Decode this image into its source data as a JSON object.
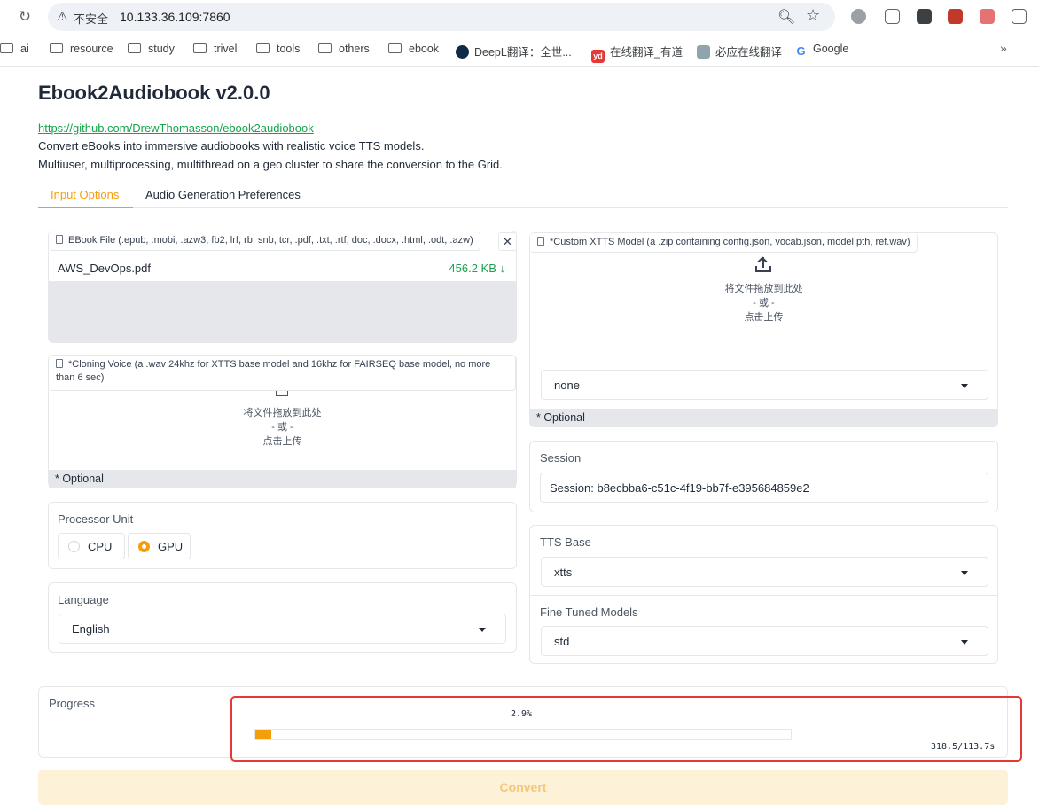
{
  "browser": {
    "security_warning": "不安全",
    "url": "10.133.36.109:7860",
    "bookmarks": [
      {
        "label": "ai",
        "type": "folder"
      },
      {
        "label": "resource",
        "type": "folder"
      },
      {
        "label": "study",
        "type": "folder"
      },
      {
        "label": "trivel",
        "type": "folder"
      },
      {
        "label": "tools",
        "type": "folder"
      },
      {
        "label": "others",
        "type": "folder"
      },
      {
        "label": "ebook",
        "type": "folder"
      },
      {
        "label": "DeepL翻译：全世...",
        "type": "site"
      },
      {
        "label": "在线翻译_有道",
        "type": "site"
      },
      {
        "label": "必应在线翻译",
        "type": "site"
      },
      {
        "label": "Google",
        "type": "site"
      }
    ],
    "bookmarks_overflow": "»"
  },
  "page": {
    "title": "Ebook2Audiobook v2.0.0",
    "github_link": "https://github.com/DrewThomasson/ebook2audiobook",
    "description_1": "Convert eBooks into immersive audiobooks with realistic voice TTS models.",
    "description_2": "Multiuser, multiprocessing, multithread on a geo cluster to share the conversion to the Grid."
  },
  "tabs": [
    {
      "label": "Input Options",
      "active": true
    },
    {
      "label": "Audio Generation Preferences",
      "active": false
    }
  ],
  "ebook_file": {
    "label": "EBook File (.epub, .mobi, .azw3, fb2, lrf, rb, snb, tcr, .pdf, .txt, .rtf, doc, .docx, .html, .odt, .azw)",
    "file_name": "AWS_DevOps.pdf",
    "file_size": "456.2 KB ↓",
    "clear_symbol": "✕"
  },
  "cloning_voice": {
    "label": "*Cloning Voice (a .wav 24khz for XTTS base model and 16khz for FAIRSEQ base model, no more than 6 sec)",
    "drop_text": "将文件拖放到此处",
    "or_text": "- 或 -",
    "click_text": "点击上传",
    "optional": "* Optional"
  },
  "processor": {
    "label": "Processor Unit",
    "options": [
      {
        "label": "CPU",
        "checked": false
      },
      {
        "label": "GPU",
        "checked": true
      }
    ]
  },
  "language": {
    "label": "Language",
    "value": "English"
  },
  "custom_model": {
    "label": "*Custom XTTS Model (a .zip containing config.json, vocab.json, model.pth, ref.wav)",
    "drop_text": "将文件拖放到此处",
    "or_text": "- 或 -",
    "click_text": "点击上传",
    "select_value": "none",
    "optional": "* Optional"
  },
  "session": {
    "label": "Session",
    "value": "Session: b8ecbba6-c51c-4f19-bb7f-e395684859e2"
  },
  "tts": {
    "base_label": "TTS Base",
    "base_value": "xtts",
    "fine_tuned_label": "Fine Tuned Models",
    "fine_tuned_value": "std"
  },
  "progress": {
    "label": "Progress",
    "percent_text": "2.9%",
    "fraction": 0.029,
    "timing": "318.5/113.7s"
  },
  "convert_button": "Convert",
  "colors": {
    "accent": "#f59e0b",
    "link": "#16a34a",
    "highlight_box": "#e53935"
  }
}
